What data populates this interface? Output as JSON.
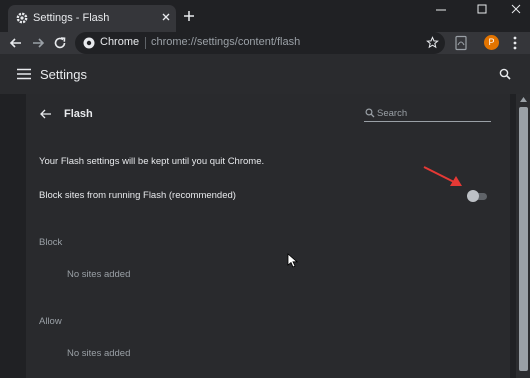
{
  "tab": {
    "title": "Settings - Flash"
  },
  "omnibox": {
    "site": "Chrome",
    "url": "chrome://settings/content/flash"
  },
  "profile": {
    "initial": "P"
  },
  "header": {
    "title": "Settings"
  },
  "page": {
    "title": "Flash",
    "search_placeholder": "Search",
    "info": "Your Flash settings will be kept until you quit Chrome.",
    "block_setting": "Block sites from running Flash (recommended)",
    "toggle_on": false
  },
  "sections": [
    {
      "heading": "Block",
      "empty": "No sites added"
    },
    {
      "heading": "Allow",
      "empty": "No sites added"
    }
  ],
  "colors": {
    "accent": "#e37400",
    "annotation": "#e53935",
    "toggle_off": "#bdc1c6"
  }
}
